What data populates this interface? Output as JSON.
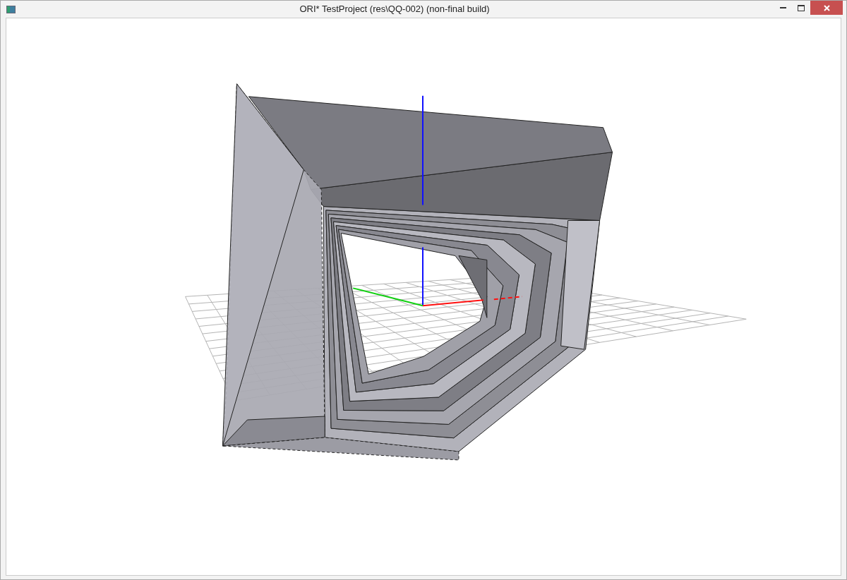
{
  "window": {
    "title": "ORI* TestProject (res\\QQ-002) (non-final build)"
  }
}
